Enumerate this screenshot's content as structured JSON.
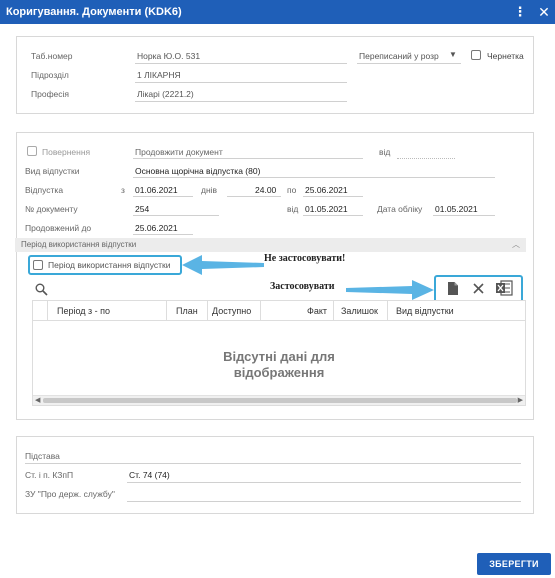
{
  "window": {
    "title": "Коригування. Документи (KDK6)"
  },
  "employee": {
    "tab_label": "Таб.номер",
    "tab_value": "Норка Ю.О. 531",
    "status_value": "Переписаний у розр",
    "draft_label": "Чернетка",
    "dept_label": "Підрозділ",
    "dept_value": "1 ЛІКАРНЯ",
    "prof_label": "Професія",
    "prof_value": "Лікарі (2221.2)"
  },
  "document": {
    "return_label": "Повернення",
    "extend_value": "Продовжити документ",
    "vid_label": "від",
    "leave_type_label": "Вид відпустки",
    "leave_type_value": "Основна щорічна відпустка (80)",
    "leave_label": "Відпустка",
    "from_label": "з",
    "from_value": "01.06.2021",
    "days_label": "днів",
    "days_value": "24.00",
    "to_label": "по",
    "to_value": "25.06.2021",
    "docnum_label": "№ документу",
    "docnum_value": "254",
    "doc_from_label": "від",
    "doc_from_value": "01.05.2021",
    "account_date_label": "Дата обліку",
    "account_date_value": "01.05.2021",
    "extended_label": "Продовжений до",
    "extended_value": "25.06.2021"
  },
  "period": {
    "section_title": "Період використання відпустки",
    "checkbox_label": "Період використання відпустки",
    "columns": [
      "Період з - по",
      "План",
      "Доступно",
      "Факт",
      "Залишок",
      "Вид відпустки"
    ],
    "empty_text": "Відсутні дані для відображення"
  },
  "annotations": {
    "not_apply": "Не застосовувати!",
    "apply": "Застосовувати"
  },
  "basis": {
    "basis_label": "Підстава",
    "article_label": "Ст. і п. КЗпП",
    "article_value": "Ст. 74 (74)",
    "law_label": "ЗУ \"Про держ. службу\""
  },
  "actions": {
    "save_label": "ЗБЕРЕГТИ"
  },
  "colors": {
    "accent": "#1f5fb8",
    "highlight": "#3aa8d8"
  }
}
